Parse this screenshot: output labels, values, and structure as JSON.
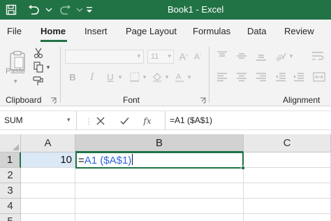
{
  "window": {
    "title": "Book1 - Excel"
  },
  "ribbon_tabs": [
    "File",
    "Home",
    "Insert",
    "Page Layout",
    "Formulas",
    "Data",
    "Review"
  ],
  "ribbon": {
    "clipboard": {
      "label": "Clipboard",
      "paste_label": "Paste"
    },
    "font": {
      "label": "Font",
      "size_value": "11",
      "bold": "B",
      "italic": "I",
      "underline": "U"
    },
    "alignment": {
      "label": "Alignment"
    }
  },
  "formula_bar": {
    "name_box": "SUM",
    "content": "=A1 ($A$1)"
  },
  "grid": {
    "columns": [
      "A",
      "B",
      "C"
    ],
    "rows": [
      "1",
      "2",
      "3",
      "4",
      "5"
    ],
    "a1_value": "10",
    "edit_prefix": "=",
    "edit_ref": "A1 ($A$1)"
  },
  "colors": {
    "accent": "#217346",
    "reference": "#3064d8",
    "selected_cell": "#dbe8f5"
  }
}
